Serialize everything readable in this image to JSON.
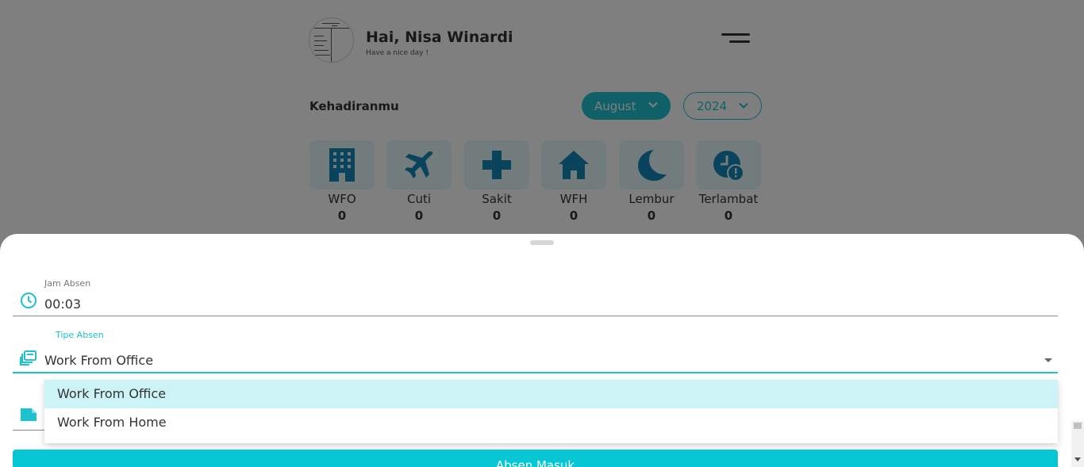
{
  "header": {
    "greeting": "Hai, Nisa Winardi",
    "subgreeting": "Have a nice day !"
  },
  "attendance": {
    "title": "Kehadiranmu",
    "month": "August",
    "year": "2024",
    "stats": [
      {
        "label": "WFO",
        "count": "0",
        "icon": "building-icon"
      },
      {
        "label": "Cuti",
        "count": "0",
        "icon": "airplane-icon"
      },
      {
        "label": "Sakit",
        "count": "0",
        "icon": "medical-cross-icon"
      },
      {
        "label": "WFH",
        "count": "0",
        "icon": "home-icon"
      },
      {
        "label": "Lembur",
        "count": "0",
        "icon": "moon-icon"
      },
      {
        "label": "Terlambat",
        "count": "0",
        "icon": "clock-alert-icon"
      }
    ]
  },
  "form": {
    "jam_label": "Jam Absen",
    "jam_value": "00:03",
    "tipe_label": "Tipe Absen",
    "tipe_value": "Work From Office",
    "options": [
      {
        "label": "Work From Office",
        "selected": true
      },
      {
        "label": "Work From Home",
        "selected": false
      }
    ],
    "submit_label": "Absen Masuk"
  },
  "colors": {
    "accent": "#1fc1cf",
    "button": "#06c7d3",
    "selected_option": "#ccf3f6",
    "icon_tile": "#e7f8fa",
    "icon": "#1589b8"
  }
}
